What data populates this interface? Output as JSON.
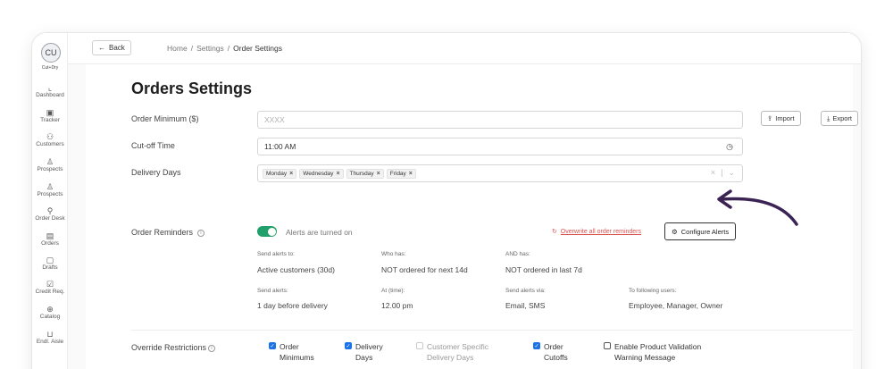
{
  "sidebar": {
    "avatar_initials": "CU",
    "org_name": "Cut+Dry",
    "items": [
      {
        "label": "Dashboard",
        "icon": "chart-icon"
      },
      {
        "label": "Tracker",
        "icon": "clipboard-icon"
      },
      {
        "label": "Customers",
        "icon": "users-icon"
      },
      {
        "label": "Prospects",
        "icon": "user-plus-icon"
      },
      {
        "label": "Prospects",
        "icon": "user-plus-icon"
      },
      {
        "label": "Order Desk",
        "icon": "order-desk-icon"
      },
      {
        "label": "Orders",
        "icon": "document-icon"
      },
      {
        "label": "Drafts",
        "icon": "draft-icon"
      },
      {
        "label": "Credit Req.",
        "icon": "credit-icon"
      },
      {
        "label": "Catalog",
        "icon": "catalog-icon"
      },
      {
        "label": "Endl. Aisle",
        "icon": "cart-icon"
      }
    ]
  },
  "topbar": {
    "back_label": "Back",
    "breadcrumb": [
      "Home",
      "Settings",
      "Order Settings"
    ]
  },
  "page": {
    "title": "Orders Settings",
    "import_label": "Import",
    "export_label": "Export"
  },
  "form": {
    "order_minimum": {
      "label": "Order Minimum ($)",
      "placeholder": "XXXX"
    },
    "cutoff_time": {
      "label": "Cut-off Time",
      "value": "11:00 AM"
    },
    "delivery_days": {
      "label": "Delivery Days",
      "selected": [
        "Monday",
        "Wednesday",
        "Thursday",
        "Friday"
      ]
    },
    "order_reminders": {
      "label": "Order Reminders",
      "toggle_label": "Alerts are turned on",
      "toggle_on": true,
      "overwrite_label": "Overwrite all order reminders",
      "configure_label": "Configure Alerts",
      "details": {
        "send_alerts_to": {
          "label": "Send alerts to:",
          "value": "Active customers (30d)"
        },
        "who_has": {
          "label": "Who has:",
          "value": "NOT ordered for next 14d"
        },
        "and_has": {
          "label": "AND has:",
          "value": "NOT ordered in last 7d"
        },
        "send_alerts": {
          "label": "Send alerts:",
          "value": "1 day before delivery"
        },
        "at_time": {
          "label": "At (time):",
          "value": "12.00 pm"
        },
        "send_via": {
          "label": "Send alerts via:",
          "value": "Email, SMS"
        },
        "to_users": {
          "label": "To following users:",
          "value": "Employee, Manager, Owner"
        }
      }
    },
    "override_restrictions": {
      "label": "Override Restrictions",
      "options": [
        {
          "line1": "Order",
          "line2": "Minimums",
          "checked": true,
          "disabled": false
        },
        {
          "line1": "Delivery",
          "line2": "Days",
          "checked": true,
          "disabled": false
        },
        {
          "line1": "Customer Specific",
          "line2": "Delivery Days",
          "checked": false,
          "disabled": true
        },
        {
          "line1": "Order",
          "line2": "Cutoffs",
          "checked": true,
          "disabled": false
        },
        {
          "line1": "Enable Product Validation",
          "line2": "Warning Message",
          "checked": false,
          "disabled": false
        }
      ]
    }
  },
  "colors": {
    "toggle_on": "#22a06b",
    "checkbox": "#1a73e8",
    "warning": "#d9534f",
    "arrow": "#3b2454"
  }
}
